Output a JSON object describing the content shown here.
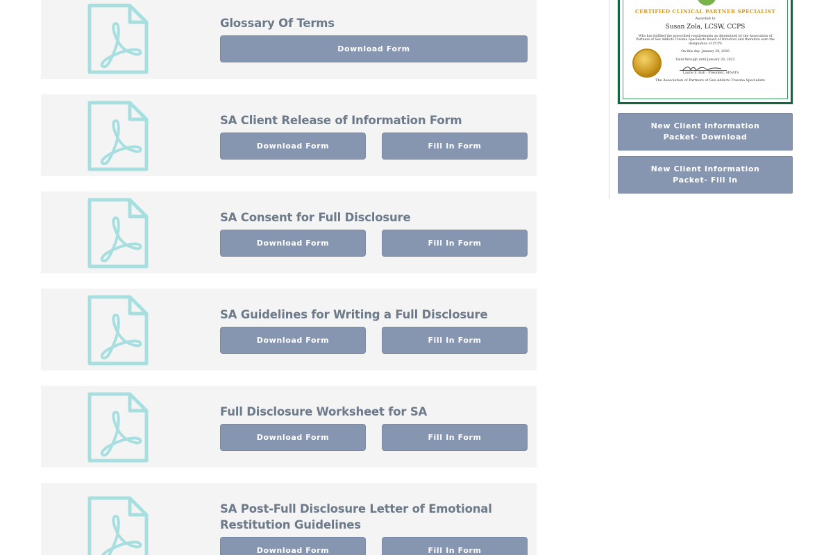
{
  "forms": [
    {
      "title": "Glossary Of Terms",
      "download_label": "Download Form",
      "fill_label": ""
    },
    {
      "title": "SA Client Release of Information Form",
      "download_label": "Download Form",
      "fill_label": "Fill In Form"
    },
    {
      "title": "SA Consent for Full Disclosure",
      "download_label": "Download Form",
      "fill_label": "Fill In Form"
    },
    {
      "title": "SA Guidelines for Writing a Full Disclosure",
      "download_label": "Download Form",
      "fill_label": "Fill In Form"
    },
    {
      "title": "Full Disclosure Worksheet for SA",
      "download_label": "Download Form",
      "fill_label": "Fill In Form"
    },
    {
      "title": "SA Post-Full Disclosure Letter of Emotional Restitution Guidelines",
      "download_label": "Download Form",
      "fill_label": "Fill In Form"
    }
  ],
  "icon": {
    "name": "pdf-document-icon",
    "color": "#a7dfe0"
  },
  "certificate": {
    "heading": "CERTIFIED CLINICAL PARTNER SPECIALIST",
    "awarded_to": "Awarded to",
    "recipient": "Susan Zola, LCSW, CCPS",
    "body": "Who has fulfilled the prescribed requirements as determined by the Association of Partners of Sex Addicts Trauma Specialists Board of Directors and therefore earn the designation of CCPS",
    "date": "On this day: January 28, 2020",
    "valid": "Valid through until January 28, 2022",
    "signer": "Laurie S. Hall · President, APSATS",
    "organization": "The Association of Partners of Sex Addicts Trauma Specialists"
  },
  "sidebar": {
    "packet_download_label": "New Client Information Packet- Download",
    "packet_fill_label": "New Client Information Packet- Fill In"
  },
  "colors": {
    "button": "#8796b0",
    "card": "#f4f4f4",
    "title": "#6c7a89",
    "icon": "#a7dfe0"
  }
}
